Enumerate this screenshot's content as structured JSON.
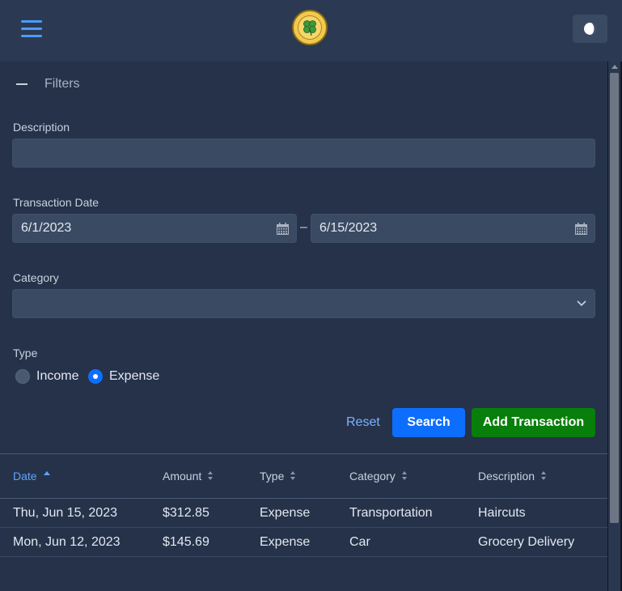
{
  "header": {
    "menu_icon": "hamburger-menu-icon",
    "logo_icon": "clover-logo-icon",
    "theme_icon": "theme-toggle-icon"
  },
  "filters": {
    "title": "Filters",
    "description": {
      "label": "Description",
      "value": ""
    },
    "transaction_date": {
      "label": "Transaction Date",
      "from": "6/1/2023",
      "separator": "–",
      "to": "6/15/2023"
    },
    "category": {
      "label": "Category",
      "value": ""
    },
    "type": {
      "label": "Type",
      "options": [
        "Income",
        "Expense"
      ],
      "selected": "Expense"
    }
  },
  "actions": {
    "reset": "Reset",
    "search": "Search",
    "add": "Add Transaction"
  },
  "table": {
    "columns": [
      "Date",
      "Amount",
      "Type",
      "Category",
      "Description"
    ],
    "sorted_column": "Date",
    "sort_direction": "asc",
    "rows": [
      {
        "date": "Thu, Jun 15, 2023",
        "amount": "$312.85",
        "type": "Expense",
        "category": "Transportation",
        "description": "Haircuts"
      },
      {
        "date": "Mon, Jun 12, 2023",
        "amount": "$145.69",
        "type": "Expense",
        "category": "Car",
        "description": "Grocery Delivery"
      }
    ]
  },
  "colors": {
    "background": "#25324a",
    "header": "#2b3a52",
    "primary": "#0d6efd",
    "success": "#087f0a",
    "link": "#7fb3ff"
  }
}
